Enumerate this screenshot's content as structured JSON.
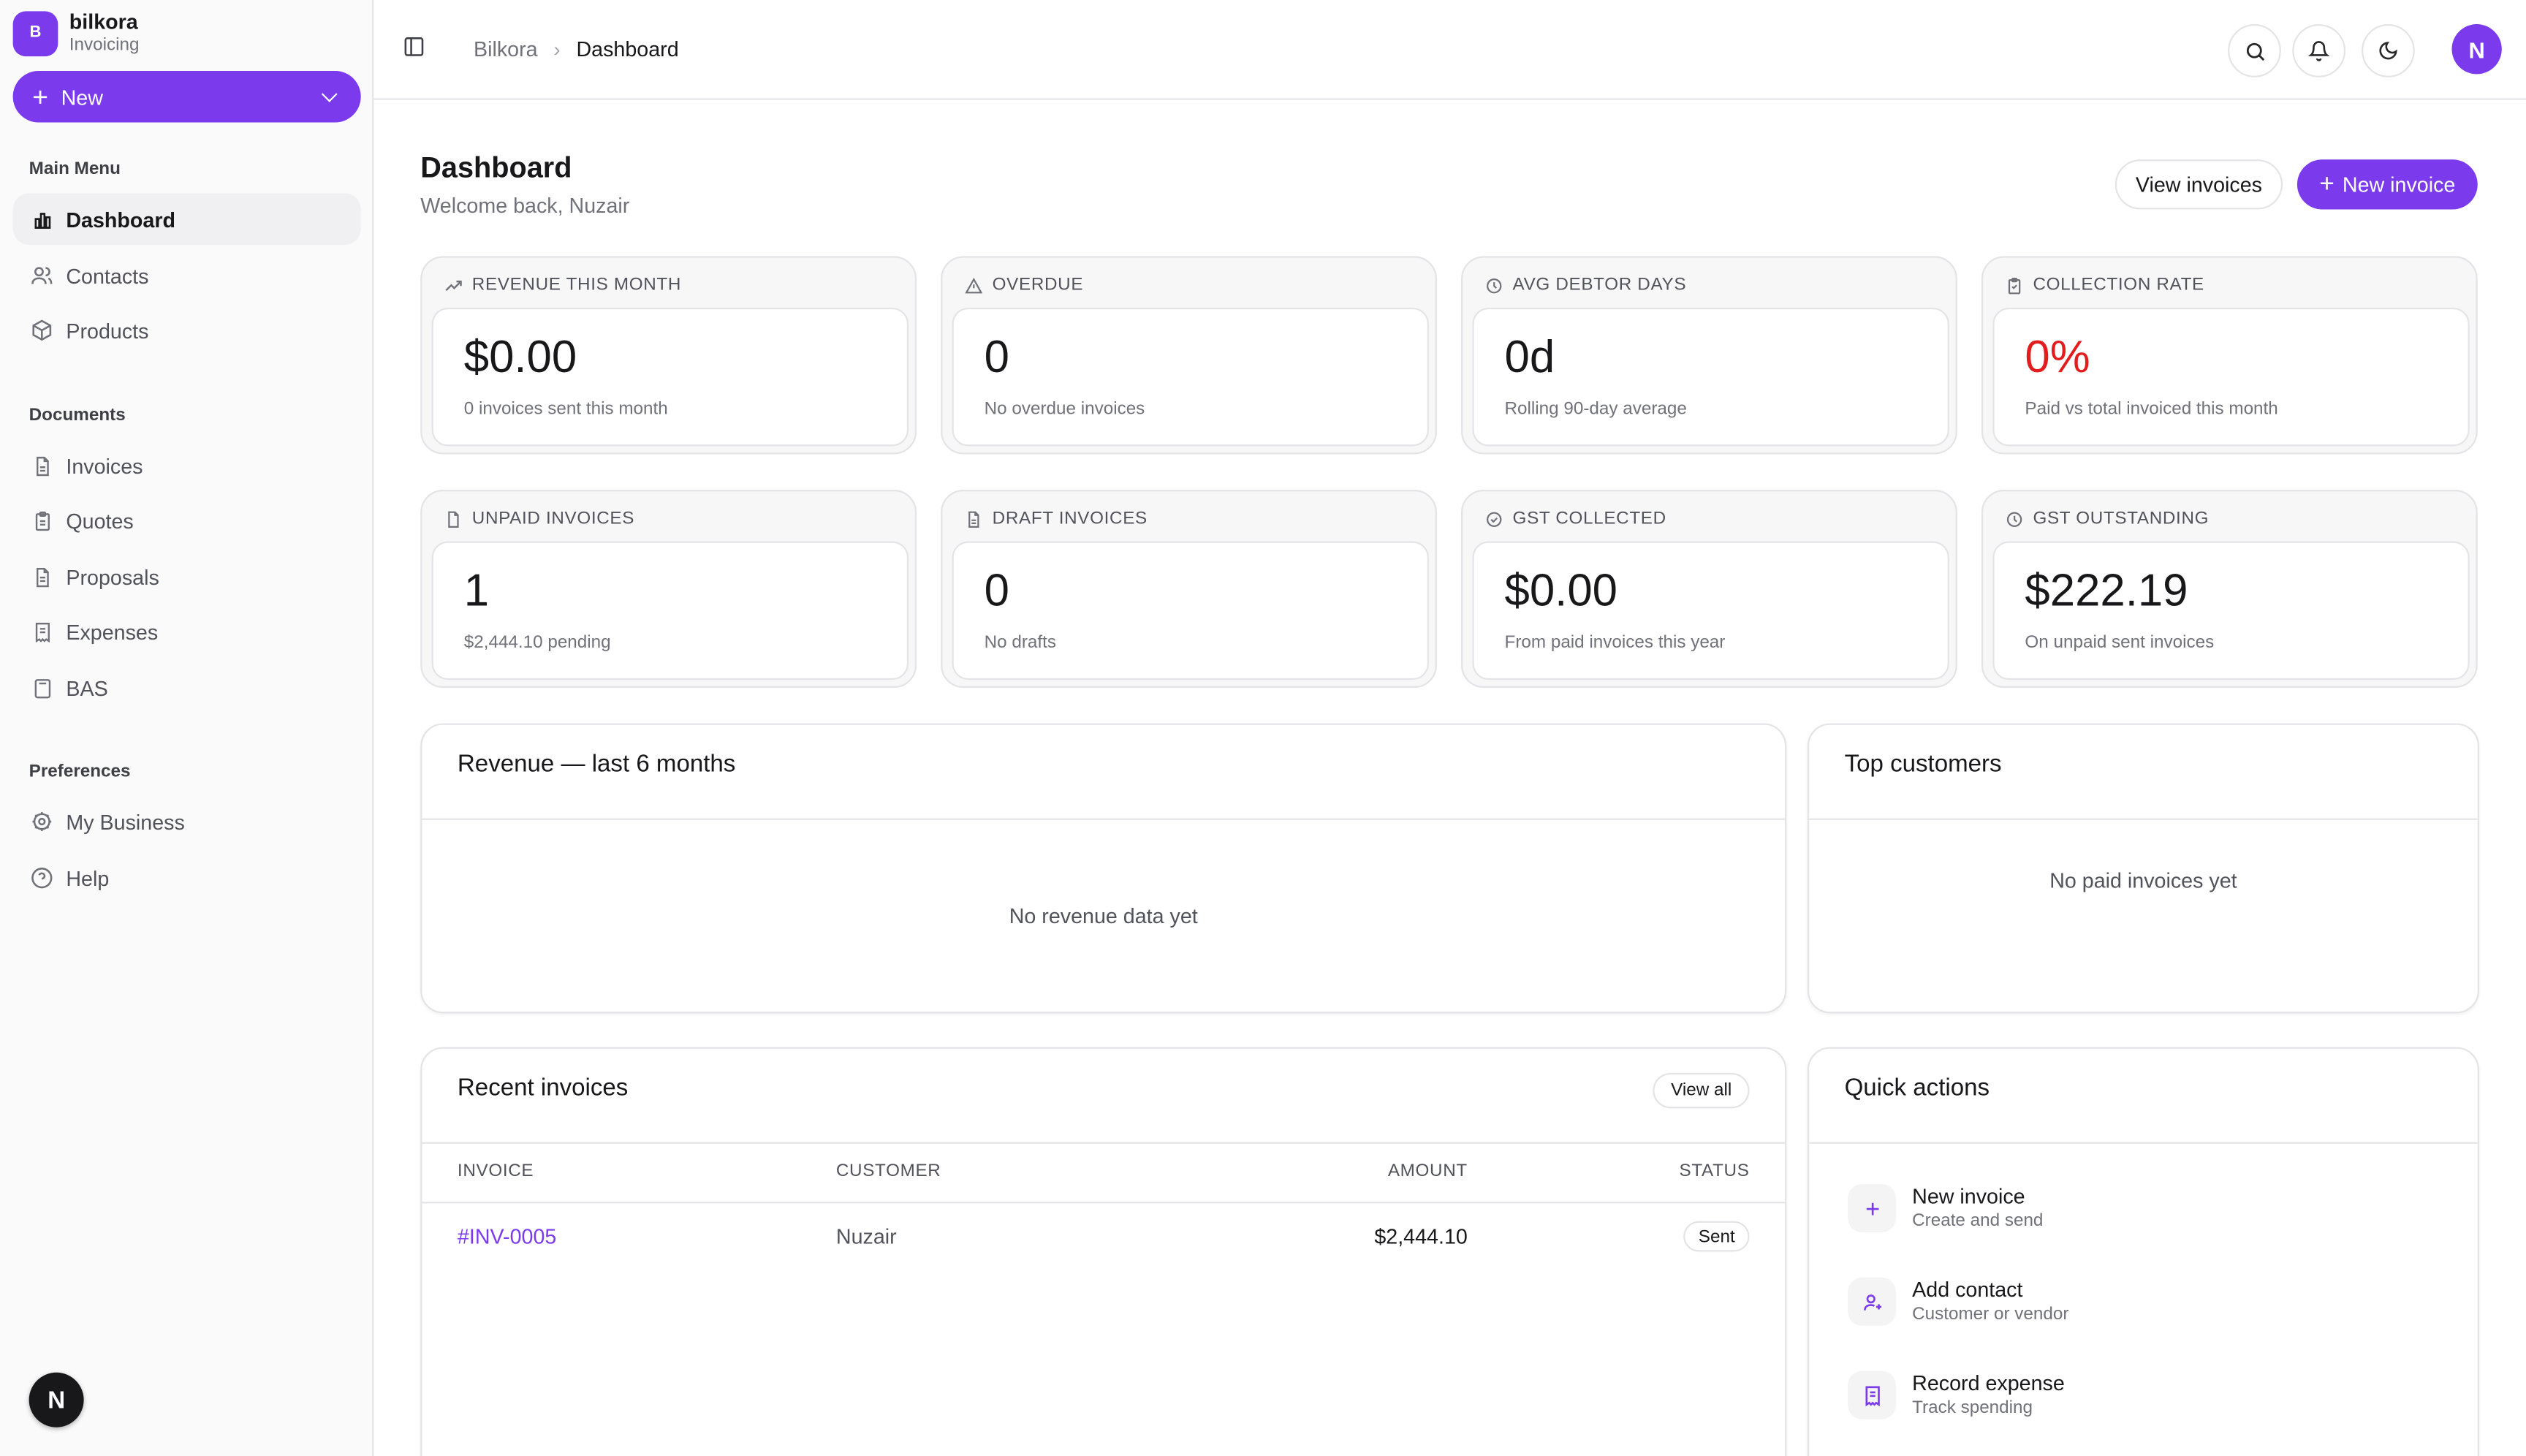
{
  "brand": {
    "logo": "B",
    "name": "bilkora",
    "subtitle": "Invoicing"
  },
  "new_button": {
    "label": "New"
  },
  "sidebar": {
    "main_menu_label": "Main Menu",
    "main_menu": [
      {
        "label": "Dashboard",
        "icon": "bar-chart-icon",
        "active": true
      },
      {
        "label": "Contacts",
        "icon": "users-icon"
      },
      {
        "label": "Products",
        "icon": "package-icon"
      }
    ],
    "documents_label": "Documents",
    "documents": [
      {
        "label": "Invoices",
        "icon": "file-text-icon"
      },
      {
        "label": "Quotes",
        "icon": "clipboard-icon"
      },
      {
        "label": "Proposals",
        "icon": "file-icon"
      },
      {
        "label": "Expenses",
        "icon": "receipt-icon"
      },
      {
        "label": "BAS",
        "icon": "calculator-icon"
      }
    ],
    "preferences_label": "Preferences",
    "preferences": [
      {
        "label": "My Business",
        "icon": "gear-icon"
      },
      {
        "label": "Help",
        "icon": "help-circle-icon"
      }
    ],
    "floating_badge": "N"
  },
  "topbar": {
    "breadcrumb": [
      "Bilkora",
      "Dashboard"
    ],
    "avatar": "N"
  },
  "page": {
    "title": "Dashboard",
    "subtitle": "Welcome back, Nuzair",
    "view_invoices_label": "View invoices",
    "new_invoice_label": "New invoice"
  },
  "stats": [
    {
      "label": "REVENUE THIS MONTH",
      "value": "$0.00",
      "note": "0 invoices sent this month",
      "icon": "trending-up-icon"
    },
    {
      "label": "OVERDUE",
      "value": "0",
      "note": "No overdue invoices",
      "icon": "alert-triangle-icon"
    },
    {
      "label": "AVG DEBTOR DAYS",
      "value": "0d",
      "note": "Rolling 90-day average",
      "icon": "clock-icon"
    },
    {
      "label": "COLLECTION RATE",
      "value": "0%",
      "note": "Paid vs total invoiced this month",
      "icon": "clipboard-check-icon",
      "color": "#e11d1d"
    },
    {
      "label": "UNPAID INVOICES",
      "value": "1",
      "note": "$2,444.10 pending",
      "icon": "file-icon"
    },
    {
      "label": "DRAFT INVOICES",
      "value": "0",
      "note": "No drafts",
      "icon": "file-text-icon"
    },
    {
      "label": "GST COLLECTED",
      "value": "$0.00",
      "note": "From paid invoices this year",
      "icon": "check-circle-icon"
    },
    {
      "label": "GST OUTSTANDING",
      "value": "$222.19",
      "note": "On unpaid sent invoices",
      "icon": "clock-icon"
    }
  ],
  "revenue_card": {
    "title": "Revenue — last 6 months",
    "empty": "No revenue data yet"
  },
  "top_customers_card": {
    "title": "Top customers",
    "empty": "No paid invoices yet"
  },
  "recent_invoices": {
    "title": "Recent invoices",
    "view_all": "View all",
    "columns": [
      "INVOICE",
      "CUSTOMER",
      "AMOUNT",
      "STATUS"
    ],
    "rows": [
      {
        "invoice": "#INV-0005",
        "customer": "Nuzair",
        "amount": "$2,444.10",
        "status": "Sent"
      }
    ]
  },
  "quick_actions": {
    "title": "Quick actions",
    "items": [
      {
        "title": "New invoice",
        "subtitle": "Create and send",
        "icon": "plus-icon"
      },
      {
        "title": "Add contact",
        "subtitle": "Customer or vendor",
        "icon": "user-plus-icon"
      },
      {
        "title": "Record expense",
        "subtitle": "Track spending",
        "icon": "receipt-icon"
      }
    ]
  },
  "colors": {
    "accent": "#7c3aed",
    "danger": "#e11d1d",
    "border": "#e4e4e7"
  }
}
